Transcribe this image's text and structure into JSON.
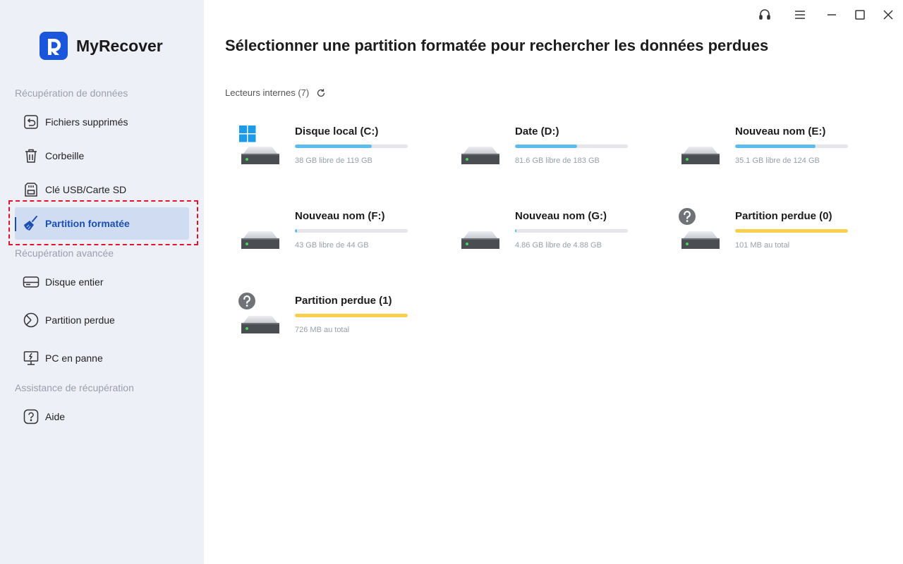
{
  "app": {
    "name": "MyRecover"
  },
  "colors": {
    "accent": "#1a56db",
    "used_bar": "#5bbdec",
    "lost_bar": "#f8cf4f",
    "highlight": "#e0142a"
  },
  "window_controls": [
    {
      "name": "support-icon"
    },
    {
      "name": "menu-icon"
    },
    {
      "name": "minimize-icon"
    },
    {
      "name": "maximize-icon"
    },
    {
      "name": "close-icon"
    }
  ],
  "sidebar": {
    "sections": [
      "Récupération de données",
      "Récupération avancée",
      "Assistance de récupération"
    ],
    "items": [
      {
        "label": "Fichiers supprimés",
        "icon": "restore-icon"
      },
      {
        "label": "Corbeille",
        "icon": "trash-icon"
      },
      {
        "label": "Clé USB/Carte SD",
        "icon": "sd-card-icon"
      },
      {
        "label": "Partition formatée",
        "icon": "broom-icon",
        "active": true
      },
      {
        "label": "Disque entier",
        "icon": "disk-icon"
      },
      {
        "label": "Partition perdue",
        "icon": "pie-icon"
      },
      {
        "label": "PC en panne",
        "icon": "broken-pc-icon"
      },
      {
        "label": "Aide",
        "icon": "help-icon"
      }
    ]
  },
  "main": {
    "title": "Sélectionner une partition formatée pour rechercher les données perdues",
    "drives_header": "Lecteurs internes (7)",
    "drives": [
      {
        "name": "Disque local (C:)",
        "info": "38 GB libre de 119 GB",
        "used": 0.68,
        "type": "system"
      },
      {
        "name": "Date (D:)",
        "info": "81.6 GB libre de 183 GB",
        "used": 0.55,
        "type": "normal"
      },
      {
        "name": "Nouveau nom (E:)",
        "info": "35.1 GB libre de 124 GB",
        "used": 0.71,
        "type": "normal"
      },
      {
        "name": "Nouveau nom (F:)",
        "info": "43 GB libre de 44 GB",
        "used": 0.02,
        "type": "normal"
      },
      {
        "name": "Nouveau nom (G:)",
        "info": "4.86 GB libre de 4.88 GB",
        "used": 0.004,
        "type": "normal"
      },
      {
        "name": "Partition perdue (0)",
        "info": "101 MB au total",
        "used": 1.0,
        "type": "lost"
      },
      {
        "name": "Partition perdue (1)",
        "info": "726 MB au total",
        "used": 1.0,
        "type": "lost"
      }
    ]
  }
}
